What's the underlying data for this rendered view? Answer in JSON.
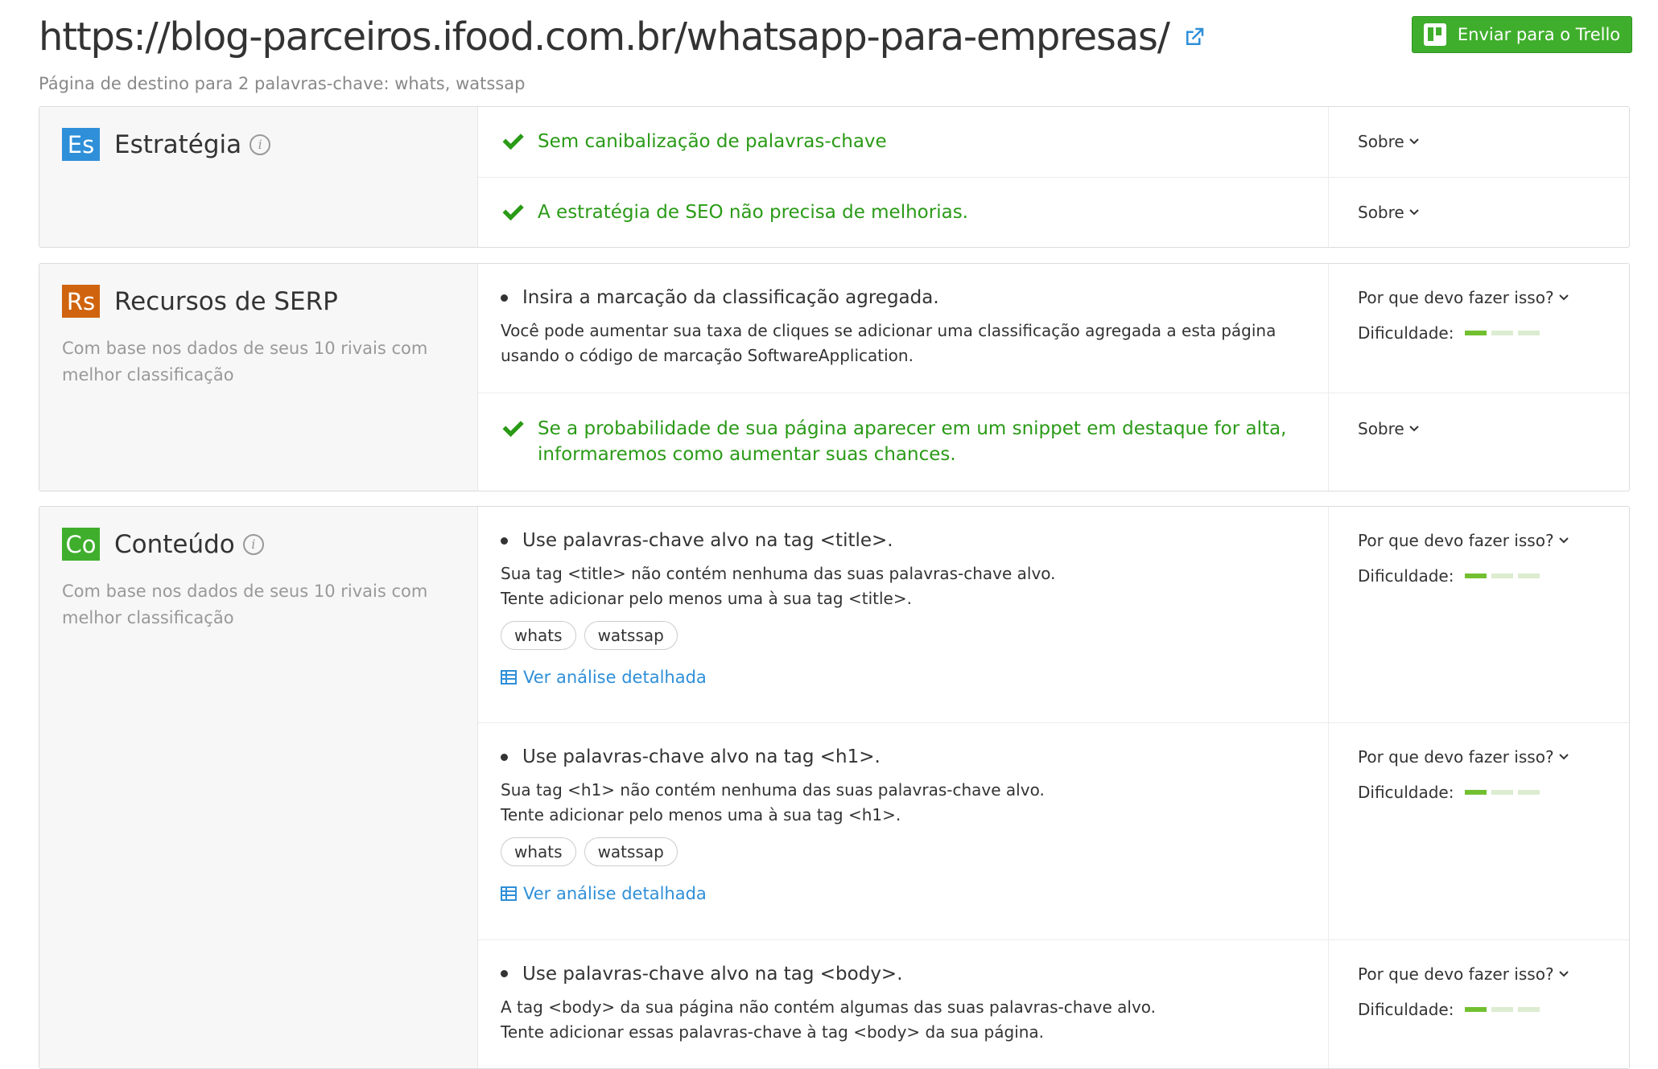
{
  "header": {
    "url": "https://blog-parceiros.ifood.com.br/whatsapp-para-empresas/",
    "subtitle": "Página de destino para 2 palavras-chave: whats, watssap",
    "trello_button": "Enviar para o Trello"
  },
  "colors": {
    "accent_green": "#3fae2c",
    "ok_green": "#2a9a17",
    "link_blue": "#2f8fd8",
    "badge_es": "#2f8fd8",
    "badge_rs": "#d0640e",
    "badge_co": "#3fae2c"
  },
  "sections": [
    {
      "badge": "Es",
      "title": "Estratégia",
      "rows": [
        {
          "text": "Sem canibalização de palavras-chave",
          "side": "Sobre"
        },
        {
          "text": "A estratégia de SEO não precisa de melhorias.",
          "side": "Sobre"
        }
      ]
    },
    {
      "badge": "Rs",
      "title": "Recursos de SERP",
      "description": "Com base nos dados de seus 10 rivais com melhor classificação",
      "rows": [
        {
          "title": "Insira a marcação da classificação agregada.",
          "desc": "Você pode aumentar sua taxa de cliques se adicionar uma classificação agregada a esta página usando o código de marcação SoftwareApplication.",
          "side": "Por que devo fazer isso?",
          "difficulty_label": "Dificuldade:",
          "difficulty_level": 1
        },
        {
          "text": "Se a probabilidade de sua página aparecer em um snippet em destaque for alta, informaremos como aumentar suas chances.",
          "side": "Sobre"
        }
      ]
    },
    {
      "badge": "Co",
      "title": "Conteúdo",
      "description": "Com base nos dados de seus 10 rivais com melhor classificação",
      "rows": [
        {
          "title": "Use palavras-chave alvo na tag <title>.",
          "desc1": "Sua tag <title> não contém nenhuma das suas palavras-chave alvo.",
          "desc2": "Tente adicionar pelo menos uma à sua tag <title>.",
          "tags": [
            "whats",
            "watssap"
          ],
          "link": "Ver análise detalhada",
          "side": "Por que devo fazer isso?",
          "difficulty_label": "Dificuldade:",
          "difficulty_level": 1
        },
        {
          "title": "Use palavras-chave alvo na tag <h1>.",
          "desc1": "Sua tag <h1> não contém nenhuma das suas palavras-chave alvo.",
          "desc2": "Tente adicionar pelo menos uma à sua tag <h1>.",
          "tags": [
            "whats",
            "watssap"
          ],
          "link": "Ver análise detalhada",
          "side": "Por que devo fazer isso?",
          "difficulty_label": "Dificuldade:",
          "difficulty_level": 1
        },
        {
          "title": "Use palavras-chave alvo na tag <body>.",
          "desc1": "A tag <body> da sua página não contém algumas das suas palavras-chave alvo.",
          "desc2": "Tente adicionar essas palavras-chave à tag <body> da sua página.",
          "side": "Por que devo fazer isso?",
          "difficulty_label": "Dificuldade:",
          "difficulty_level": 1
        }
      ]
    }
  ]
}
